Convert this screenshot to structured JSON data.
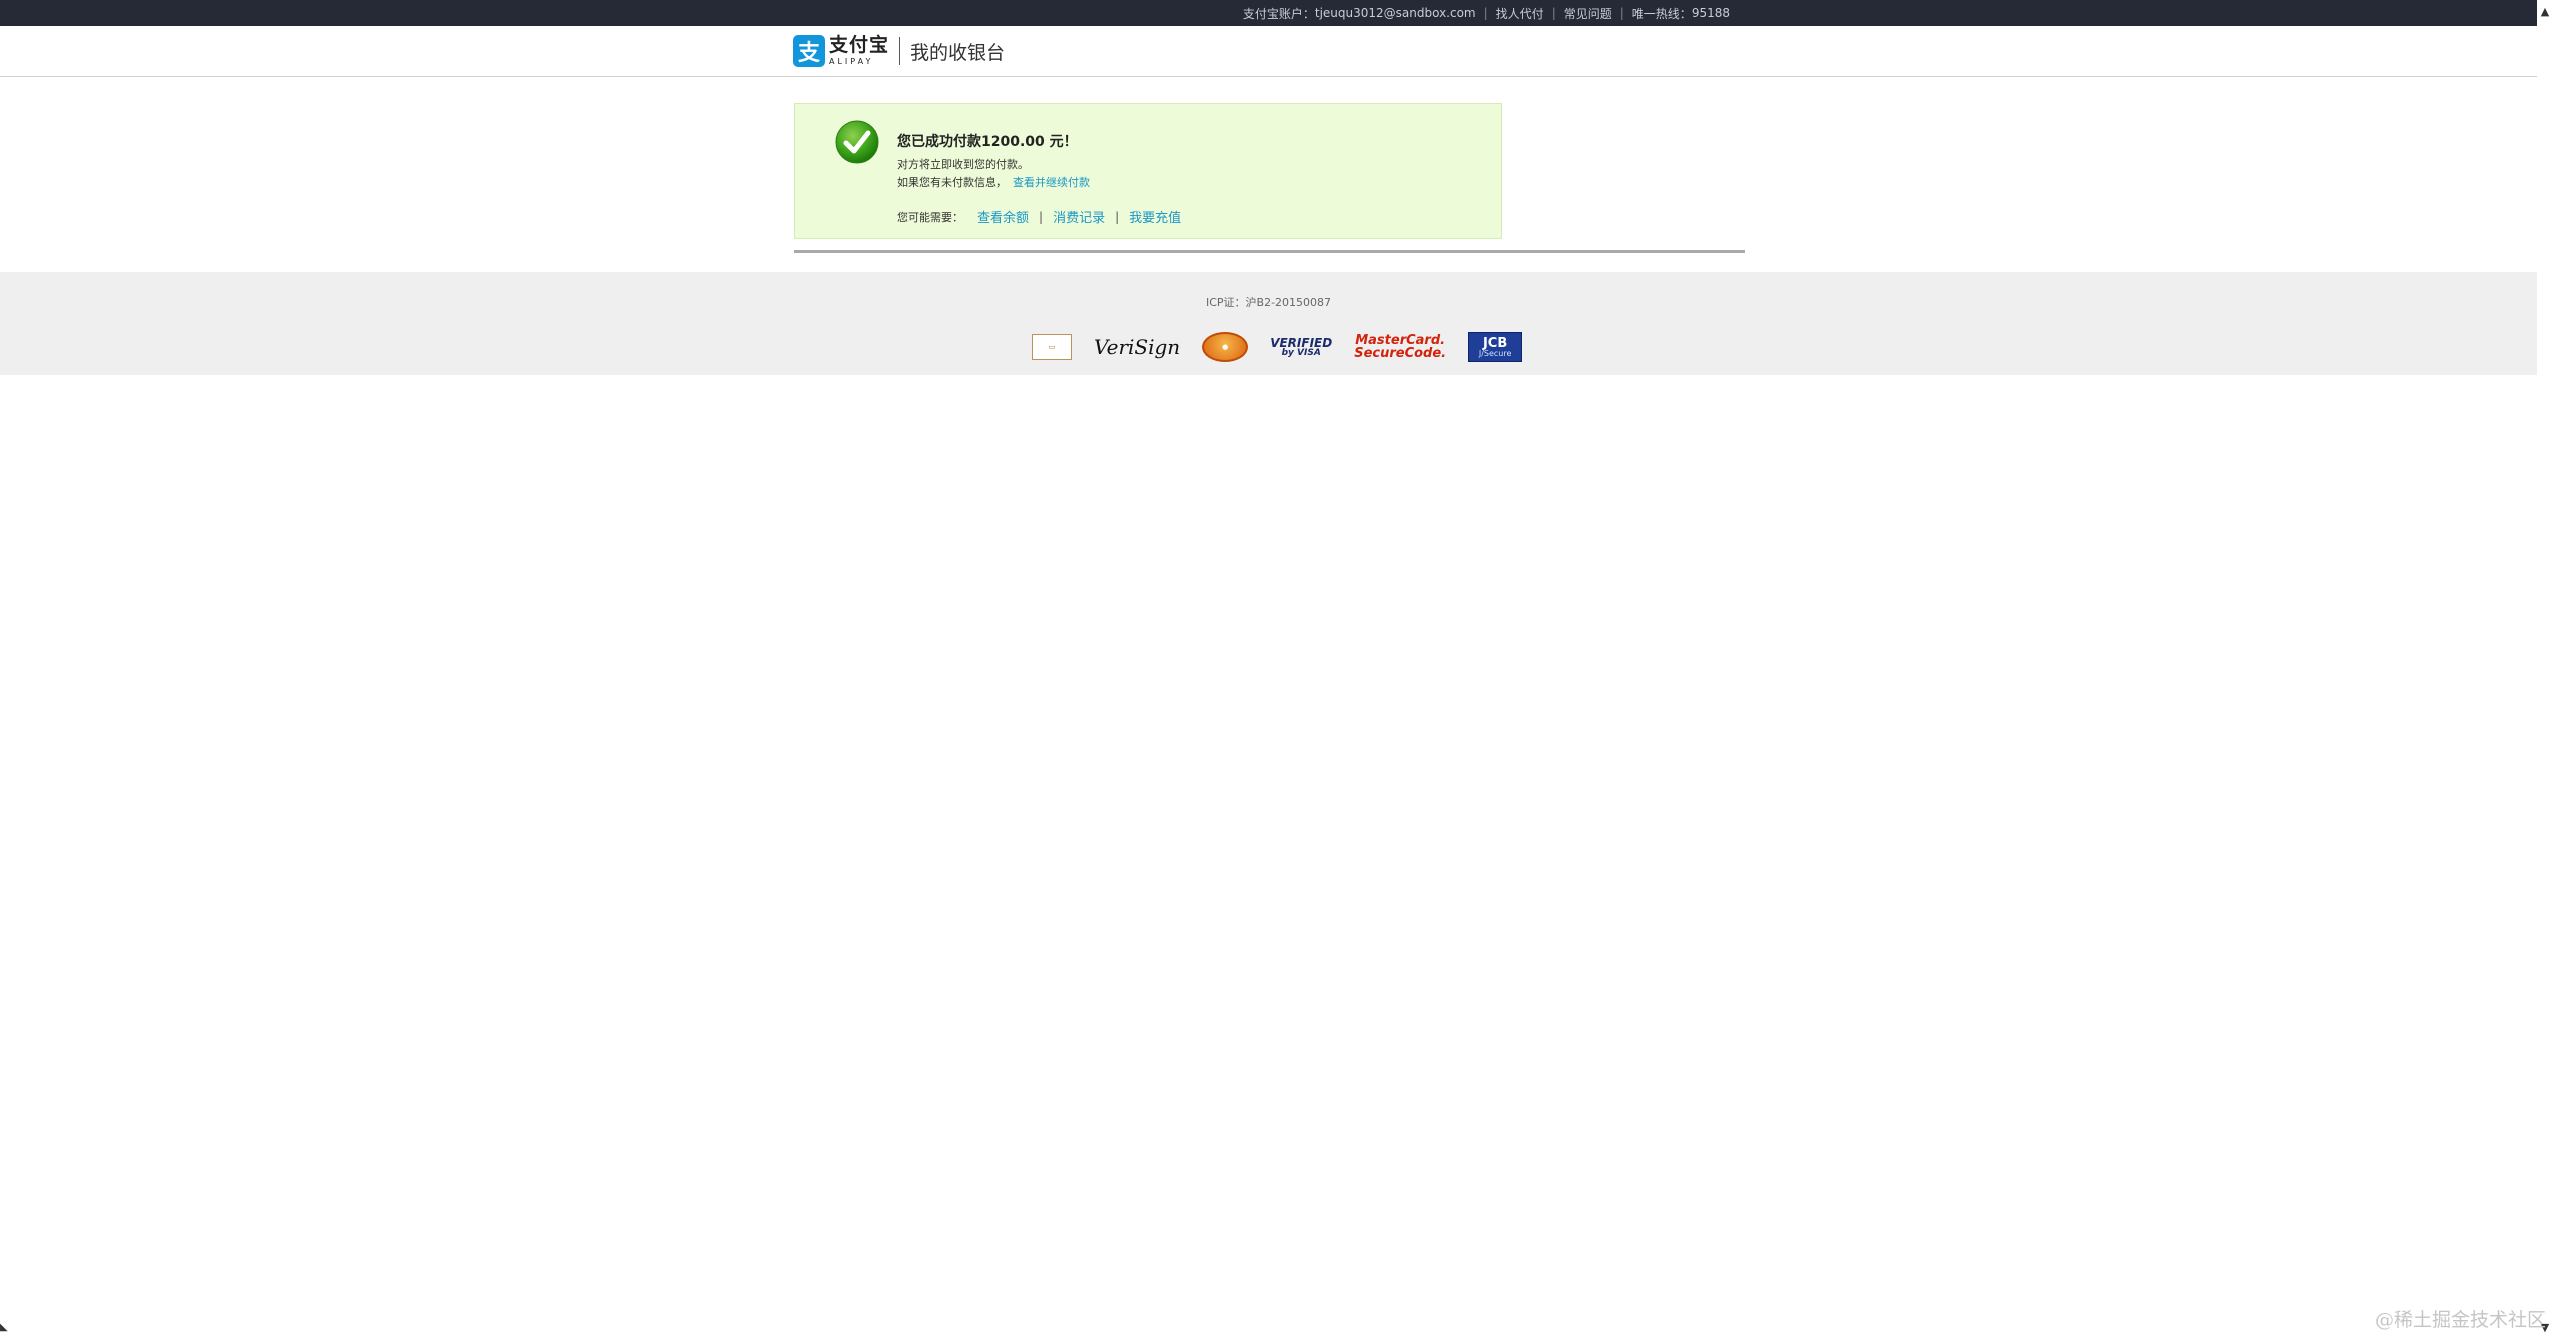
{
  "topbar": {
    "account_label": "支付宝账户：",
    "account_email": "tjeuqu3012@sandbox.com",
    "links": [
      "找人代付",
      "常见问题"
    ],
    "hotline_label": "唯一热线：",
    "hotline_number": "95188"
  },
  "header": {
    "logo_cn": "支付宝",
    "logo_en": "ALIPAY",
    "logo_mark": "支",
    "cashier_title": "我的收银台"
  },
  "success": {
    "title": "您已成功付款1200.00 元！",
    "line1": "对方将立即收到您的付款。",
    "line2_prefix": "如果您有未付款信息，",
    "line2_link": "查看并继续付款",
    "needs_label": "您可能需要：",
    "actions": [
      "查看余额",
      "消费记录",
      "我要充值"
    ],
    "separator": "|"
  },
  "footer": {
    "icp": "ICP证：沪B2-20150087",
    "badges": {
      "verisign": "VeriSign",
      "visa_line1": "VERIFIED",
      "visa_line2": "by VISA",
      "mc_line1": "MasterCard.",
      "mc_line2": "SecureCode.",
      "jcb_line1": "JCB",
      "jcb_line2": "J/Secure"
    }
  },
  "watermark": "@稀土掘金技术社区",
  "icons": {
    "check": "check-icon",
    "scroll_up": "chevron-up-icon",
    "scroll_down": "chevron-down-icon"
  },
  "colors": {
    "topbar_bg": "#262a36",
    "success_bg": "#eefbd8",
    "link_blue": "#1a97c6",
    "alipay_blue": "#1296db",
    "footer_bg": "#efefef"
  }
}
